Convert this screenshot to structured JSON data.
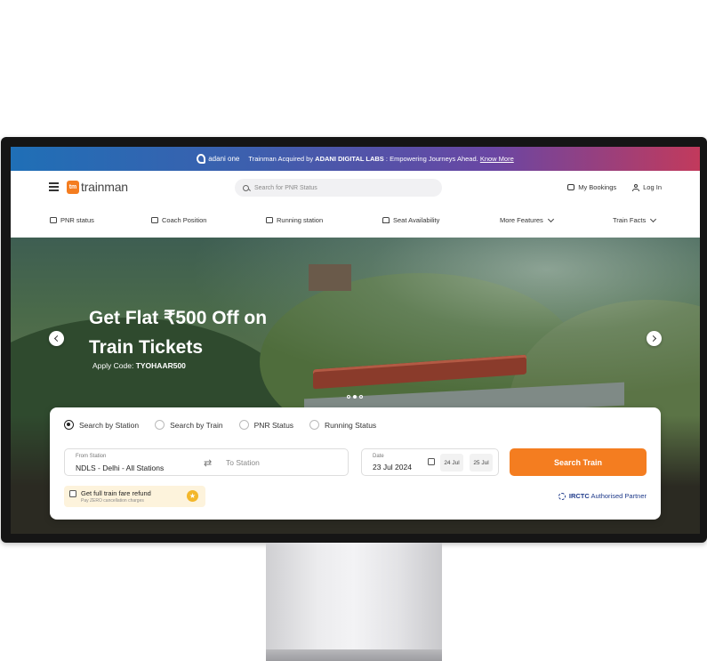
{
  "banner": {
    "logo_text": "adani one",
    "text_prefix": "Trainman Acquired by",
    "text_bold": "ADANI DIGITAL LABS",
    "text_suffix": ": Empowering Journeys Ahead.",
    "link": "Know More"
  },
  "header": {
    "logo_badge": "tm",
    "logo_text": "trainman",
    "search_placeholder": "Search for PNR Status",
    "my_bookings": "My Bookings",
    "log_in": "Log In"
  },
  "nav": {
    "items": [
      "PNR status",
      "Coach Position",
      "Running station",
      "Seat Availability",
      "More Features",
      "Train Facts"
    ]
  },
  "hero": {
    "title_line1": "Get Flat ₹500 Off on",
    "title_line2": "Train Tickets",
    "code_label": "Apply Code:",
    "code_value": "TYOHAAR500",
    "active_slide": 2,
    "slide_count": 3
  },
  "search_card": {
    "modes": [
      "Search by Station",
      "Search by Train",
      "PNR Status",
      "Running Status"
    ],
    "selected_mode": "Search by Station",
    "from_label": "From Station",
    "from_value": "NDLS - Delhi - All Stations",
    "to_placeholder": "To Station",
    "date_label": "Date",
    "date_value": "23 Jul 2024",
    "quick_dates": [
      "24 Jul",
      "25 Jul"
    ],
    "search_button": "Search Train",
    "refund_title": "Get full train fare refund",
    "refund_sub": "Pay ZERO cancellation charges",
    "partner_bold": "IRCTC",
    "partner_text": "Authorised Partner"
  },
  "colors": {
    "accent": "#f47d20",
    "partner": "#1e3a8a"
  }
}
